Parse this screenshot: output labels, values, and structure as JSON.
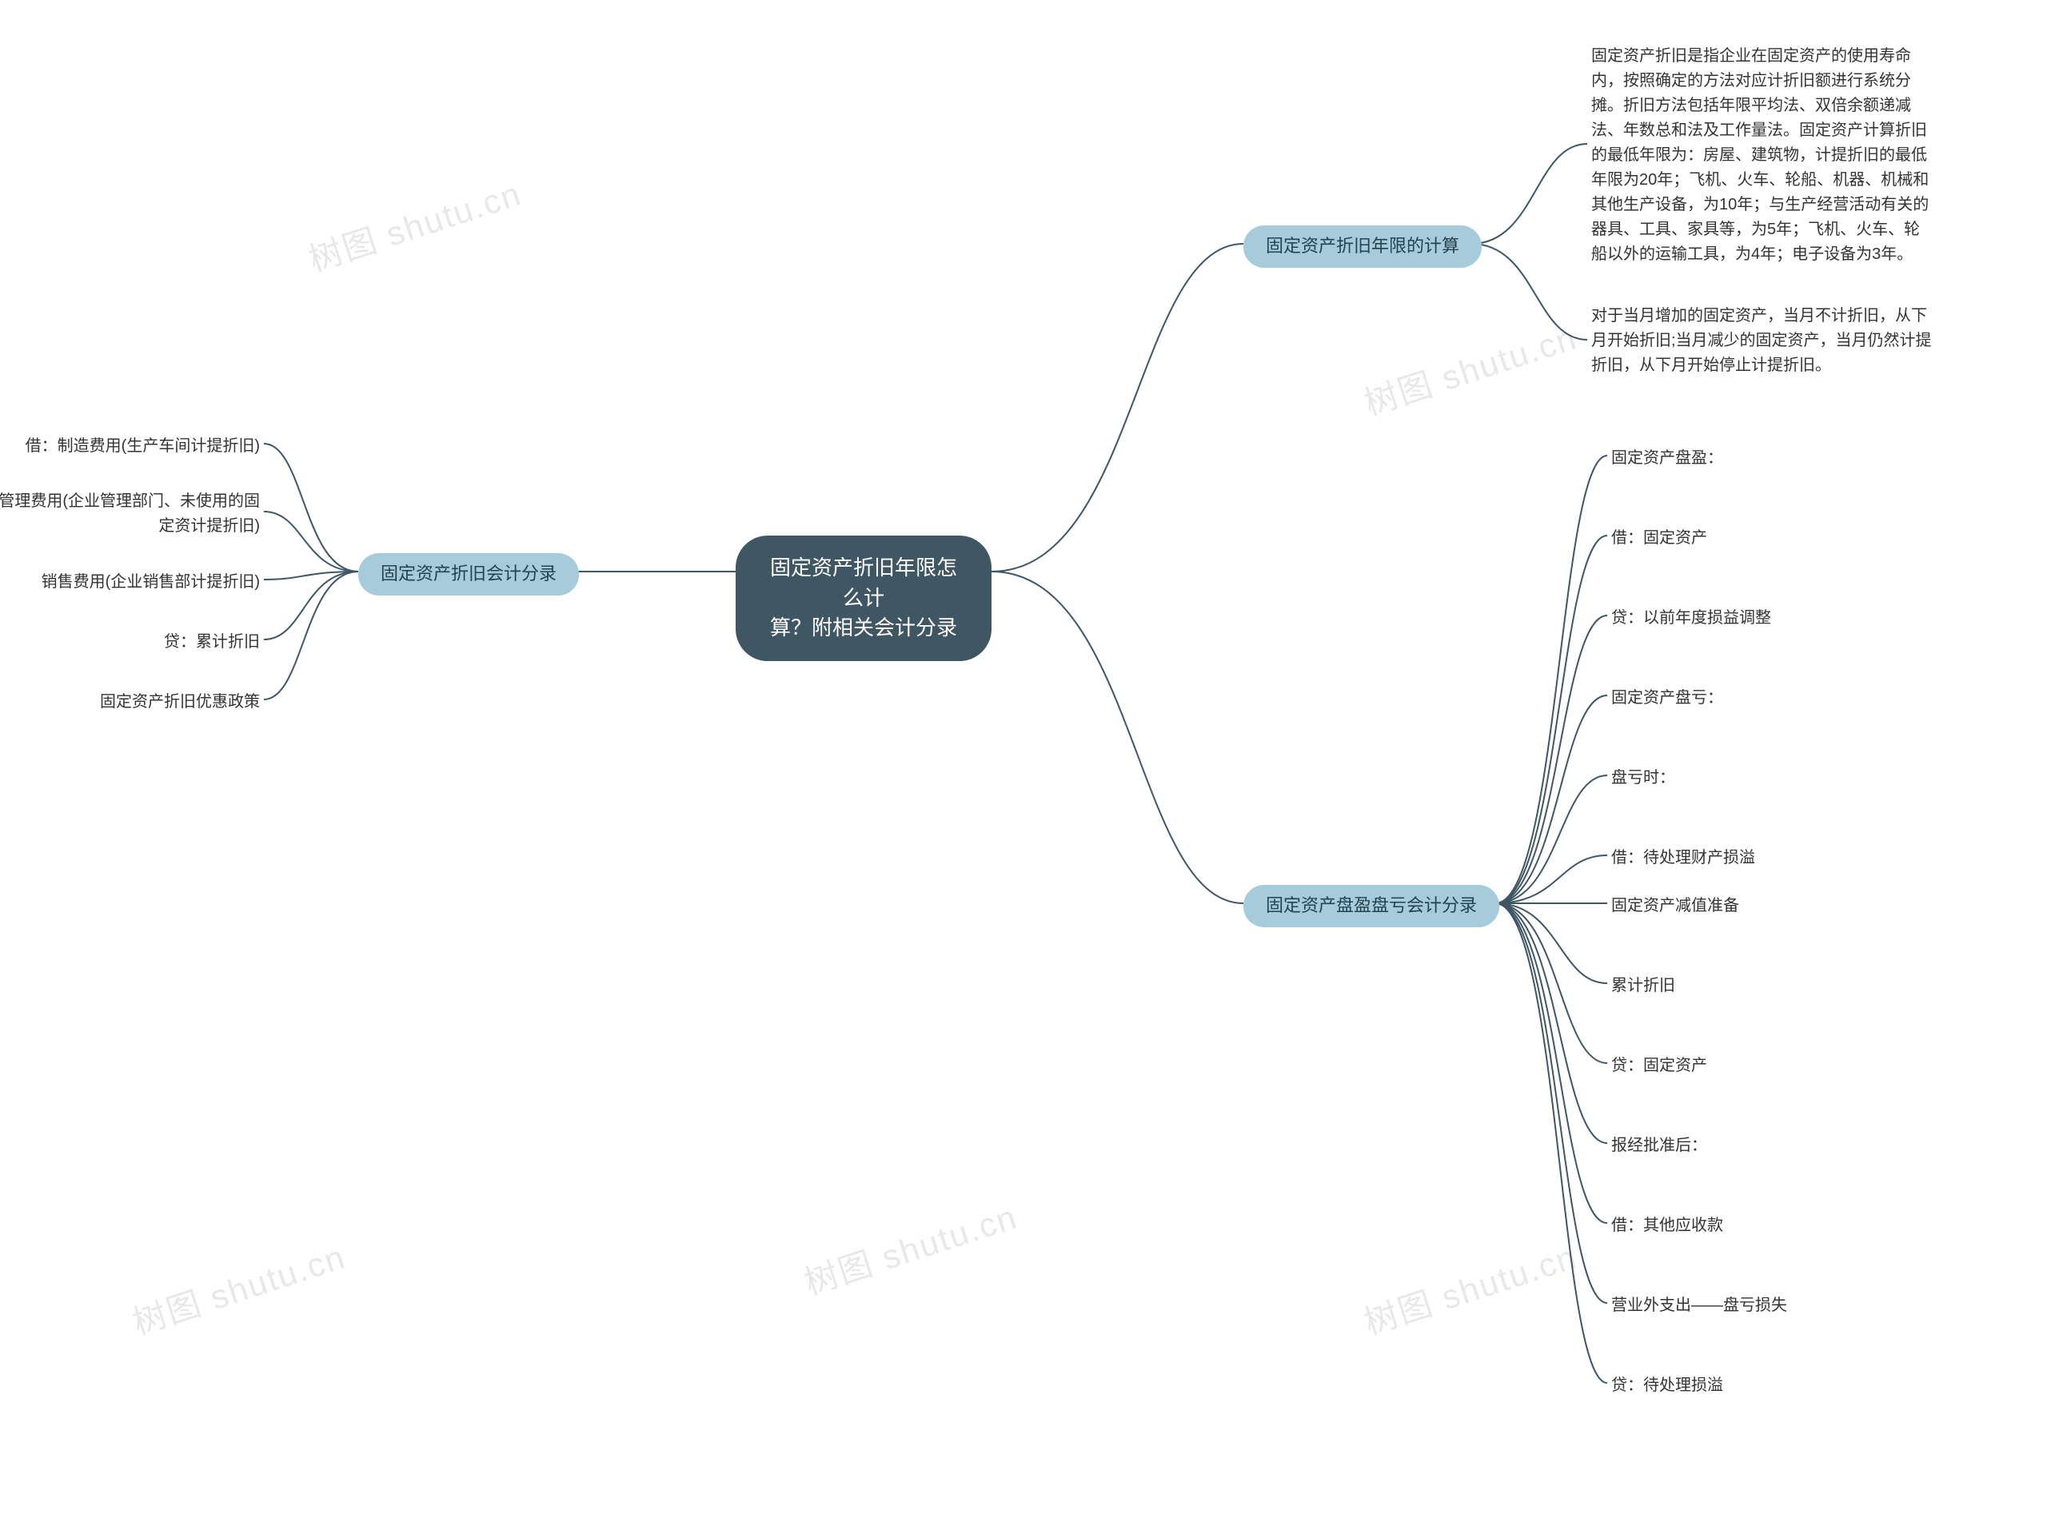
{
  "center": {
    "line1": "固定资产折旧年限怎么计",
    "line2": "算？附相关会计分录"
  },
  "branches": {
    "right_top": {
      "title": "固定资产折旧年限的计算",
      "leaves": [
        "固定资产折旧是指企业在固定资产的使用寿命内，按照确定的方法对应计折旧额进行系统分摊。折旧方法包括年限平均法、双倍余额递减法、年数总和法及工作量法。固定资产计算折旧的最低年限为：房屋、建筑物，计提折旧的最低年限为20年；飞机、火车、轮船、机器、机械和其他生产设备，为10年；与生产经营活动有关的器具、工具、家具等，为5年；飞机、火车、轮船以外的运输工具，为4年；电子设备为3年。",
        "对于当月增加的固定资产，当月不计折旧，从下月开始折旧;当月减少的固定资产，当月仍然计提折旧，从下月开始停止计提折旧。"
      ]
    },
    "right_bottom": {
      "title": "固定资产盘盈盘亏会计分录",
      "leaves": [
        "固定资产盘盈：",
        "借：固定资产",
        "贷：以前年度损益调整",
        "固定资产盘亏：",
        "盘亏时：",
        "借：待处理财产损溢",
        "固定资产减值准备",
        "累计折旧",
        "贷：固定资产",
        "报经批准后：",
        "借：其他应收款",
        "营业外支出——盘亏损失",
        "贷：待处理损溢"
      ]
    },
    "left": {
      "title": "固定资产折旧会计分录",
      "leaves": [
        "借：制造费用(生产车间计提折旧)",
        "管理费用(企业管理部门、未使用的固定资计提折旧)",
        "销售费用(企业销售部计提折旧)",
        "贷：累计折旧",
        "固定资产折旧优惠政策"
      ]
    }
  },
  "watermark": "树图 shutu.cn"
}
